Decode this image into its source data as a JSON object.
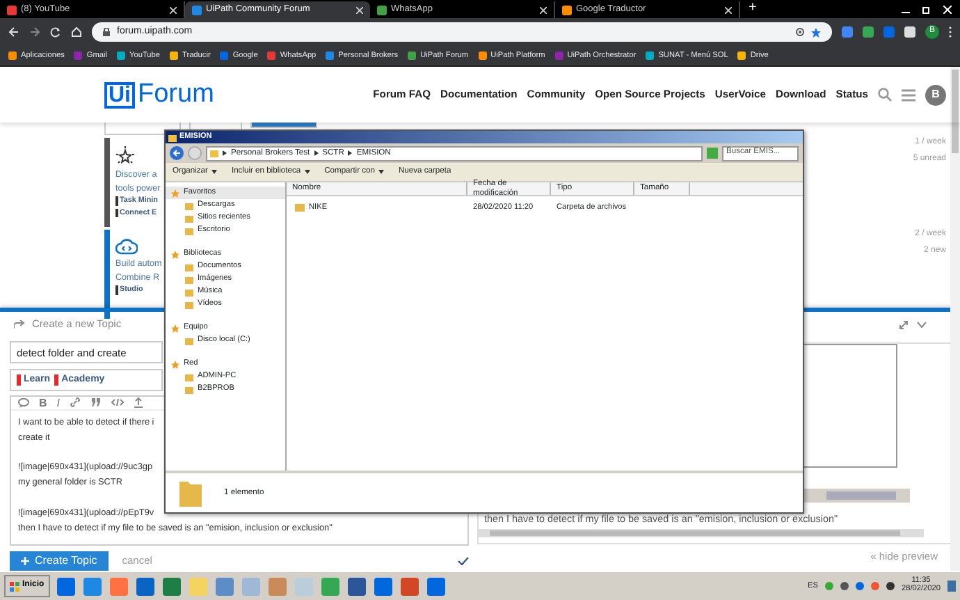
{
  "browser": {
    "tabs": [
      {
        "label": "(8) YouTube",
        "selected": false
      },
      {
        "label": "UiPath Community Forum",
        "selected": true
      },
      {
        "label": "WhatsApp",
        "selected": false
      },
      {
        "label": "Google Traductor",
        "selected": false
      }
    ],
    "new_tab": "+",
    "url": "forum.uipath.com",
    "profile": "B",
    "bookmarks": [
      "Aplicaciones",
      "Gmail",
      "YouTube",
      "Traducir",
      "Google",
      "WhatsApp",
      "Personal Brokers",
      "UiPath Forum",
      "UiPath Platform",
      "UiPath Orchestrator",
      "SUNAT - Menú SOL",
      "Drive"
    ]
  },
  "forum": {
    "logo_mark": "Ui",
    "logo_text": "Forum",
    "nav": [
      "Forum FAQ",
      "Documentation",
      "Community",
      "Open Source Projects",
      "UserVoice",
      "Download",
      "Status"
    ],
    "avatar": "B",
    "topics": [
      {
        "kind": "star",
        "lines": [
          "Discover a",
          "tools power"
        ],
        "tags": [
          "Task Minin",
          "Connect E"
        ],
        "activity": "1 / week",
        "unread": "5 unread"
      },
      {
        "kind": "cloud",
        "lines": [
          "Build autom",
          "Combine R"
        ],
        "tags": [
          "Studio"
        ],
        "activity": "2 / week",
        "unread": "2 new"
      }
    ]
  },
  "composer": {
    "heading": "Create a new Topic",
    "title_value": "detect folder and create",
    "categories": [
      "Learn",
      "Academy"
    ],
    "toolbar_letters": [
      "B",
      "I"
    ],
    "editor_paragraphs": [
      [
        "I want to be able to detect if there i",
        "create it"
      ],
      [
        "![image|690x431](upload://9uc3gp",
        "my general folder is SCTR"
      ],
      [
        "![image|690x431](upload://pEpT9v",
        "then I have to detect if my file to be saved is an \"emision, inclusion or exclusion\""
      ]
    ],
    "preview_text": "then I have to detect if my file to be saved is an \"emision, inclusion or exclusion\"",
    "submit": "Create Topic",
    "cancel": "cancel",
    "hide_preview": "« hide preview"
  },
  "explorer": {
    "title": "EMISION",
    "path": [
      "Personal Brokers Test",
      "SCTR",
      "EMISION"
    ],
    "search_placeholder": "Buscar EMIS...",
    "toolbar": [
      {
        "label": "Organizar",
        "dropdown": true
      },
      {
        "label": "Incluir en biblioteca",
        "dropdown": true
      },
      {
        "label": "Compartir con",
        "dropdown": true
      },
      {
        "label": "Nueva carpeta",
        "dropdown": false
      }
    ],
    "nav": [
      {
        "label": "Favoritos",
        "selected": true,
        "children": [
          {
            "label": "Descargas",
            "selected": false
          },
          {
            "label": "Sitios recientes",
            "selected": false
          },
          {
            "label": "Escritorio",
            "selected": false
          }
        ]
      },
      {
        "label": "Bibliotecas",
        "selected": false,
        "children": [
          {
            "label": "Documentos",
            "selected": false
          },
          {
            "label": "Imágenes",
            "selected": false
          },
          {
            "label": "Música",
            "selected": false
          },
          {
            "label": "Vídeos",
            "selected": false
          }
        ]
      },
      {
        "label": "Equipo",
        "selected": false,
        "children": [
          {
            "label": "Disco local (C:)",
            "selected": false
          }
        ]
      },
      {
        "label": "Red",
        "selected": false,
        "children": [
          {
            "label": "ADMIN-PC",
            "selected": false
          },
          {
            "label": "B2BPROB",
            "selected": false
          }
        ]
      }
    ],
    "columns": [
      "Nombre",
      "Fecha de modificación",
      "Tipo",
      "Tamaño"
    ],
    "rows": [
      {
        "name": "NIKE",
        "modified": "28/02/2020 11:20",
        "type": "Carpeta de archivos"
      }
    ],
    "status": "1 elemento"
  },
  "taskbar": {
    "start": "Inicio",
    "language": "ES",
    "time": "11:35",
    "date": "28/02/2020"
  }
}
